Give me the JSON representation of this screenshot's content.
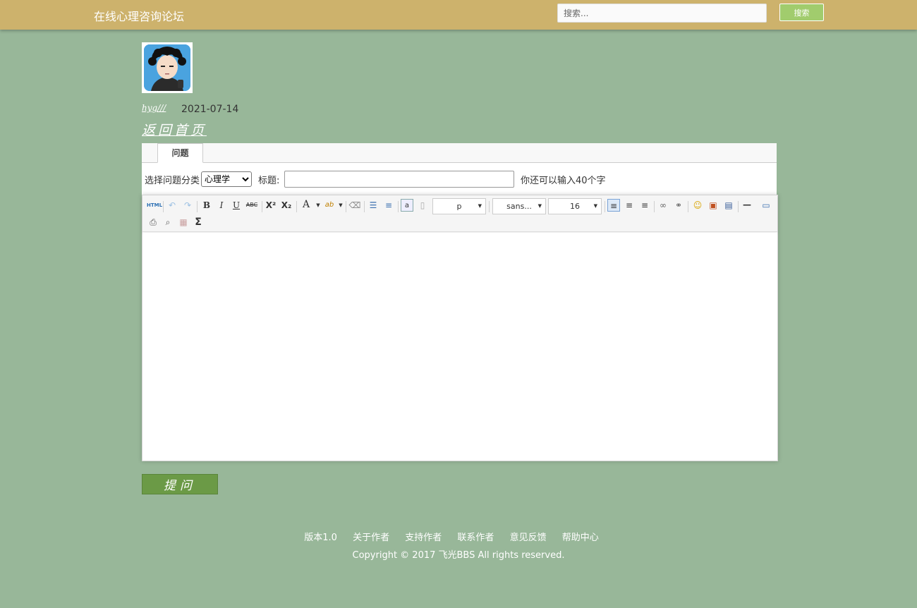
{
  "header": {
    "brand": "在线心理咨询论坛",
    "search_placeholder": "搜索...",
    "search_button": "搜索"
  },
  "post": {
    "username": "hyg///",
    "date": "2021-07-14",
    "back_home": "返回首页"
  },
  "form": {
    "tab_label": "问题",
    "category_label": "选择问题分类",
    "category_selected": "心理学",
    "title_label": "标题:",
    "title_value": "",
    "char_hint": "你还可以输入40个字"
  },
  "editor": {
    "toolbar": {
      "html_label": "HTML",
      "bold": "B",
      "italic": "I",
      "underline": "U",
      "strike": "ABC",
      "superscript": "X²",
      "subscript": "X₂",
      "font_color": "A",
      "paragraph": "p",
      "font_family": "sans...",
      "font_size": "16",
      "formula": "Σ"
    },
    "content": ""
  },
  "submit_label": "提问",
  "footer": {
    "links": [
      "版本1.0",
      "关于作者",
      "支持作者",
      "联系作者",
      "意见反馈",
      "帮助中心"
    ],
    "copyright": "Copyright © 2017 飞光BBS All rights reserved."
  },
  "colors": {
    "background": "#98b799",
    "header": "#cdb26c",
    "search_button": "#a1cc6d",
    "submit_button": "#6b9a46"
  }
}
